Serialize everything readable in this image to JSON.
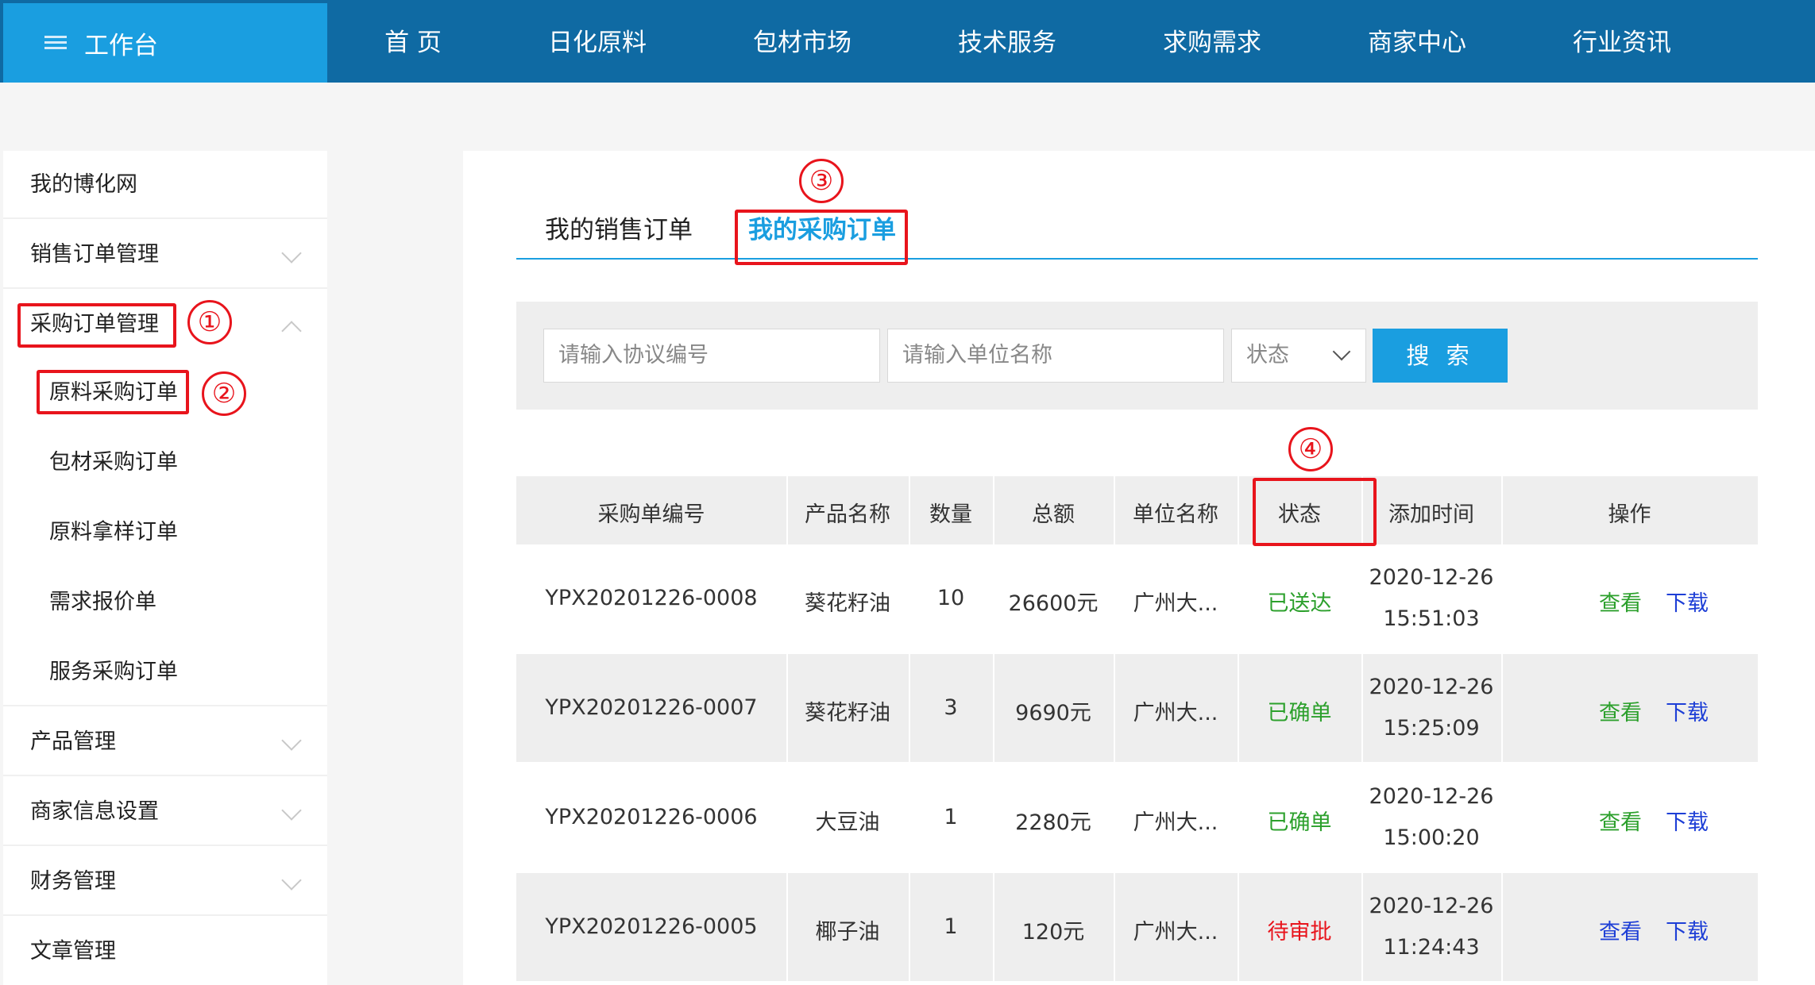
{
  "header": {
    "brand": "工作台",
    "nav": [
      "首 页",
      "日化原料",
      "包材市场",
      "技术服务",
      "求购需求",
      "商家中心",
      "行业资讯"
    ]
  },
  "sidebar": {
    "items": [
      {
        "label": "我的博化网"
      },
      {
        "label": "销售订单管理"
      },
      {
        "label": "采购订单管理"
      },
      {
        "label": "原料采购订单"
      },
      {
        "label": "包材采购订单"
      },
      {
        "label": "原料拿样订单"
      },
      {
        "label": "需求报价单"
      },
      {
        "label": "服务采购订单"
      },
      {
        "label": "产品管理"
      },
      {
        "label": "商家信息设置"
      },
      {
        "label": "财务管理"
      },
      {
        "label": "文章管理"
      }
    ]
  },
  "tabs": [
    "我的销售订单",
    "我的采购订单"
  ],
  "search": {
    "agreement_placeholder": "请输入协议编号",
    "unit_placeholder": "请输入单位名称",
    "status_select": "状态",
    "button": "搜 索"
  },
  "table": {
    "headers": [
      "采购单编号",
      "产品名称",
      "数量",
      "总额",
      "单位名称",
      "状态",
      "添加时间",
      "操作"
    ],
    "rows": [
      {
        "id": "YPX20201226-0008",
        "product": "葵花籽油",
        "qty": "10",
        "total": "26600元",
        "unit": "广州大...",
        "status": "已送达",
        "date": "2020-12-26",
        "time": "15:51:03",
        "view": "查看",
        "download": "下载"
      },
      {
        "id": "YPX20201226-0007",
        "product": "葵花籽油",
        "qty": "3",
        "total": "9690元",
        "unit": "广州大...",
        "status": "已确单",
        "date": "2020-12-26",
        "time": "15:25:09",
        "view": "查看",
        "download": "下载"
      },
      {
        "id": "YPX20201226-0006",
        "product": "大豆油",
        "qty": "1",
        "total": "2280元",
        "unit": "广州大...",
        "status": "已确单",
        "date": "2020-12-26",
        "time": "15:00:20",
        "view": "查看",
        "download": "下载"
      },
      {
        "id": "YPX20201226-0005",
        "product": "椰子油",
        "qty": "1",
        "total": "120元",
        "unit": "广州大...",
        "status": "待审批",
        "date": "2020-12-26",
        "time": "11:24:43",
        "view": "查看",
        "download": "下载"
      }
    ]
  },
  "annotations": [
    "①",
    "②",
    "③",
    "④"
  ],
  "colors": {
    "nav": "#0f6aa3",
    "accent": "#1a9ee0",
    "green": "#2ca02c",
    "red": "#e8141c",
    "link": "#1e3fd6"
  }
}
